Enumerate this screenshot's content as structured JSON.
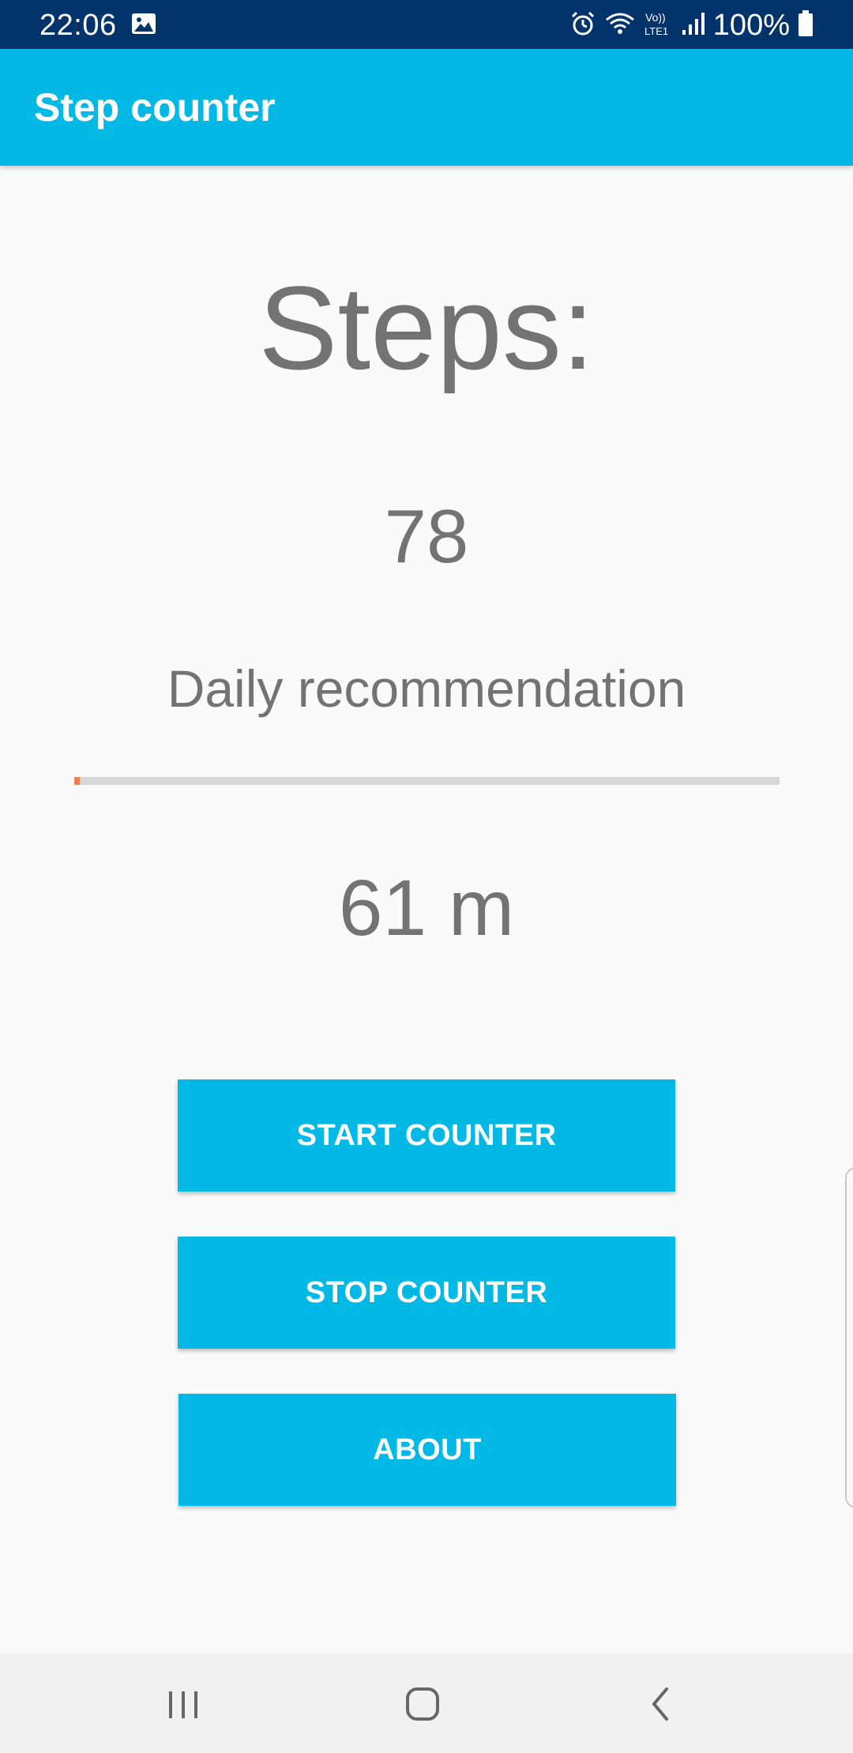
{
  "status_bar": {
    "time": "22:06",
    "battery_percent": "100%",
    "icons": [
      "image-icon",
      "alarm-icon",
      "wifi-icon",
      "volte-lte-icon",
      "signal-icon",
      "battery-icon"
    ]
  },
  "app_bar": {
    "title": "Step counter"
  },
  "main": {
    "steps_label": "Steps:",
    "steps_count": "78",
    "daily_label": "Daily recommendation",
    "daily_progress": 0.008,
    "distance": "61 m"
  },
  "buttons": {
    "start": "START COUNTER",
    "stop": "STOP COUNTER",
    "about": "ABOUT"
  },
  "nav_bar": {
    "icons": [
      "recents-icon",
      "home-icon",
      "back-icon"
    ]
  },
  "colors": {
    "status_bar": "#02336b",
    "accent": "#02b8e4",
    "text_gray": "#737373",
    "progress_track": "#d8d8d8",
    "progress_fill": "#f07f4f",
    "background": "#fafafa"
  }
}
